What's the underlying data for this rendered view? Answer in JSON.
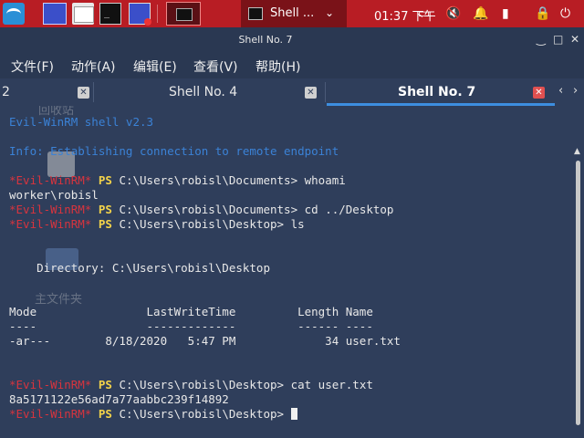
{
  "panel": {
    "task_label": "Shell ...",
    "clock": "01:37 下午",
    "accent_color": "#b81d24"
  },
  "window": {
    "title": "Shell No. 7"
  },
  "menu": [
    "文件(F)",
    "动作(A)",
    "编辑(E)",
    "查看(V)",
    "帮助(H)"
  ],
  "tabs": [
    {
      "label": "2"
    },
    {
      "label": "Shell No. 4"
    },
    {
      "label": "Shell No. 7",
      "active": true
    }
  ],
  "desktop_ghost": {
    "recycle": "回收站",
    "home": "主文件夹"
  },
  "terminal": {
    "banner": "Evil-WinRM shell v2.3",
    "info": "Info: Establishing connection to remote endpoint",
    "prompt_tag": "*Evil-WinRM*",
    "ps": "PS",
    "lines": {
      "l1_path": "C:\\Users\\robisl\\Documents> whoami",
      "l2": "worker\\robisl",
      "l3_path": "C:\\Users\\robisl\\Documents> cd ../Desktop",
      "l4_path": "C:\\Users\\robisl\\Desktop> ls",
      "dir_header": "    Directory: C:\\Users\\robisl\\Desktop",
      "cols": "Mode                LastWriteTime         Length Name",
      "dashes": "----                -------------         ------ ----",
      "row": "-ar---        8/18/2020   5:47 PM             34 user.txt",
      "l5_path": "C:\\Users\\robisl\\Desktop> cat user.txt",
      "hash": "8a5171122e56ad7a77aabbc239f14892",
      "l6_path": "C:\\Users\\robisl\\Desktop> "
    }
  }
}
